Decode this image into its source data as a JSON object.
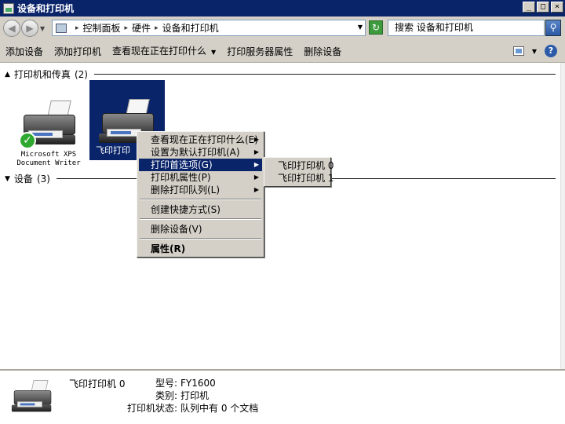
{
  "window": {
    "title": "设备和打印机",
    "controls": [
      "_",
      "□",
      "×"
    ]
  },
  "address": {
    "breadcrumbs": [
      "控制面板",
      "硬件",
      "设备和打印机"
    ],
    "search_placeholder": "搜索 设备和打印机"
  },
  "commands": {
    "add_device": "添加设备",
    "add_printer": "添加打印机",
    "see_printing": "查看现在正在打印什么",
    "print_server_props": "打印服务器属性",
    "remove_device": "删除设备"
  },
  "groups": {
    "printers": {
      "name": "打印机和传真",
      "count": "(2)"
    },
    "devices": {
      "name": "设备",
      "count": "(3)"
    }
  },
  "devices": {
    "xps": {
      "label": "Microsoft XPS\nDocument Writer"
    },
    "feiyin": {
      "label": "飞印打印"
    }
  },
  "context_menu": {
    "items": [
      "查看现在正在打印什么(E)",
      "设置为默认打印机(A)",
      "打印首选项(G)",
      "打印机属性(P)",
      "删除打印队列(L)",
      "创建快捷方式(S)",
      "删除设备(V)",
      "属性(R)"
    ]
  },
  "submenu": {
    "items": [
      "飞印打印机 0",
      "飞印打印机 1"
    ]
  },
  "details": {
    "device_name": "飞印打印机 0",
    "model_label": "型号:",
    "model_value": "FY1600",
    "category_label": "类别:",
    "category_value": "打印机",
    "status_label": "打印机状态:",
    "status_value": "队列中有 0 个文档"
  },
  "colors": {
    "selection": "#0a246a",
    "chrome": "#d4d0c8"
  }
}
